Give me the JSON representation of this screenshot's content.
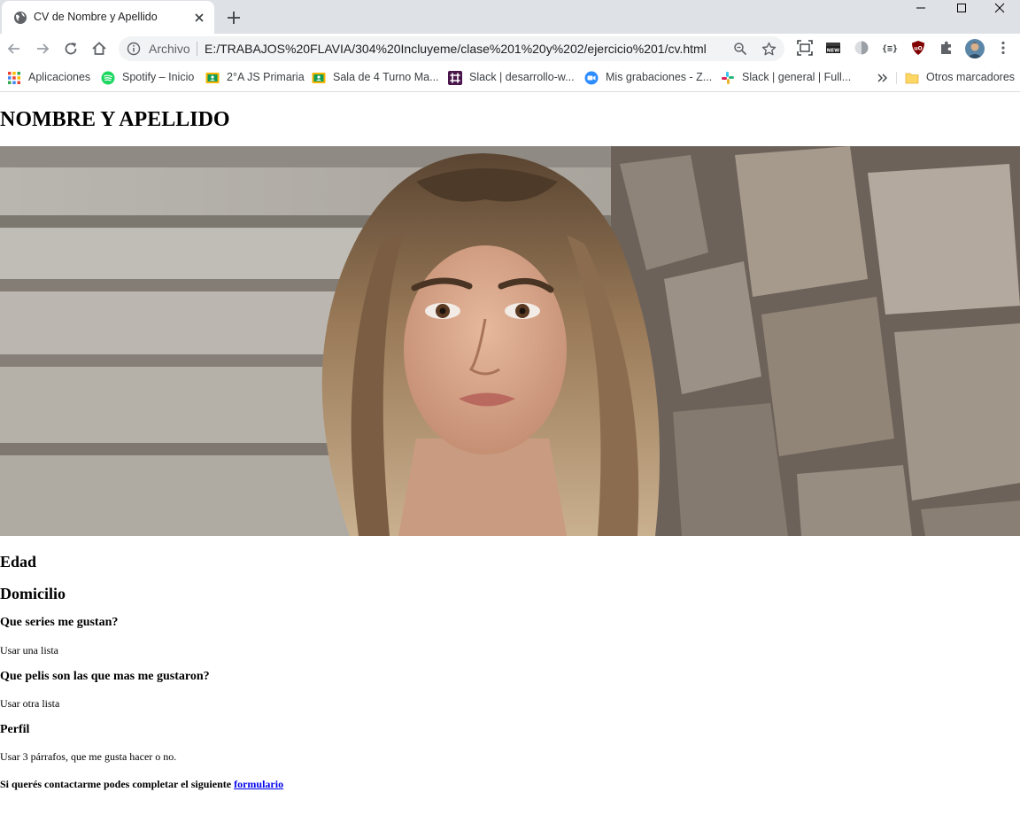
{
  "browser": {
    "tab": {
      "title": "CV de Nombre y Apellido"
    },
    "omnibox": {
      "chip": "Archivo",
      "url": "E:/TRABAJOS%20FLAVIA/304%20Incluyeme/clase%201%20y%202/ejercicio%201/cv.html"
    },
    "bookmarks": [
      {
        "label": "Aplicaciones",
        "icon": "apps-grid-icon"
      },
      {
        "label": "Spotify – Inicio",
        "icon": "spotify-icon"
      },
      {
        "label": "2°A JS Primaria",
        "icon": "classroom-icon"
      },
      {
        "label": "Sala de 4 Turno Ma...",
        "icon": "classroom-icon"
      },
      {
        "label": "Slack | desarrollo-w...",
        "icon": "slack-icon"
      },
      {
        "label": "Mis grabaciones - Z...",
        "icon": "zoom-icon"
      },
      {
        "label": "Slack | general | Full...",
        "icon": "slack-icon"
      }
    ],
    "other_bookmarks": {
      "label": "Otros marcadores",
      "icon": "folder-icon"
    },
    "colors": {
      "tabbar": "#dee1e6",
      "omnibox": "#f1f3f4",
      "link": "#0000ee"
    }
  },
  "page": {
    "title": "NOMBRE Y APELLIDO",
    "photo": {
      "subject": "portrait-photo"
    },
    "sections": {
      "edad": "Edad",
      "domicilio": "Domicilio",
      "series_heading": "Que series me gustan?",
      "series_text": "Usar una lista",
      "pelis_heading": "Que pelis son las que mas me gustaron?",
      "pelis_text": "Usar otra lista",
      "perfil_heading": "Perfil",
      "perfil_text": "Usar 3 párrafos, que me gusta hacer o no."
    },
    "contact": {
      "text": "Si querés contactarme podes completar el siguiente ",
      "link_label": "formulario"
    }
  }
}
